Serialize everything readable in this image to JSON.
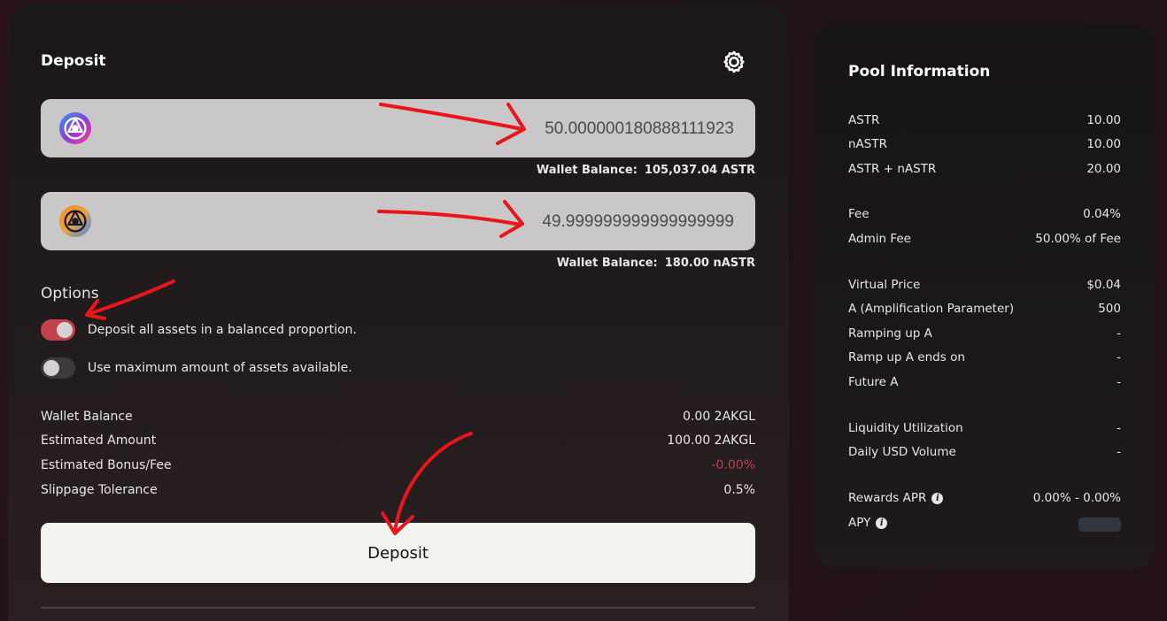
{
  "deposit": {
    "title": "Deposit",
    "icons": {
      "settings": "gear-icon",
      "token1": "astr-token-icon",
      "token2": "nastr-token-icon"
    },
    "inputs": [
      {
        "value": "50.000000180888111923",
        "wallet_label": "Wallet Balance:",
        "wallet_value": "105,037.04 ASTR"
      },
      {
        "value": "49.999999999999999999",
        "wallet_label": "Wallet Balance:",
        "wallet_value": "180.00 nASTR"
      }
    ],
    "options": {
      "title": "Options",
      "toggles": [
        {
          "label": "Deposit all assets in a balanced proportion.",
          "on": true
        },
        {
          "label": "Use maximum amount of assets available.",
          "on": false
        }
      ]
    },
    "summary": [
      {
        "label": "Wallet Balance",
        "value": "0.00 2AKGL"
      },
      {
        "label": "Estimated Amount",
        "value": "100.00 2AKGL"
      },
      {
        "label": "Estimated Bonus/Fee",
        "value": "-0.00%"
      },
      {
        "label": "Slippage Tolerance",
        "value": "0.5%"
      }
    ],
    "button_label": "Deposit"
  },
  "pool": {
    "title": "Pool Information",
    "rows": [
      {
        "label": "ASTR",
        "value": "10.00"
      },
      {
        "label": "nASTR",
        "value": "10.00"
      },
      {
        "label": "ASTR + nASTR",
        "value": "20.00"
      },
      {
        "label": "Fee",
        "value": "0.04%"
      },
      {
        "label": "Admin Fee",
        "value": "50.00% of Fee"
      },
      {
        "label": "Virtual Price",
        "value": "$0.04"
      },
      {
        "label": "A (Amplification Parameter)",
        "value": "500"
      },
      {
        "label": "Ramping up A",
        "value": "-"
      },
      {
        "label": "Ramp up A ends on",
        "value": "-"
      },
      {
        "label": "Future A",
        "value": "-"
      },
      {
        "label": "Liquidity Utilization",
        "value": "-"
      },
      {
        "label": "Daily USD Volume",
        "value": "-"
      },
      {
        "label": "Rewards APR",
        "value": "0.00% - 0.00%"
      },
      {
        "label": "APY",
        "value": ""
      }
    ]
  },
  "colors": {
    "accent": "#c2414b",
    "annotation_arrow": "#e8161b",
    "negative_value": "#b8434b"
  }
}
